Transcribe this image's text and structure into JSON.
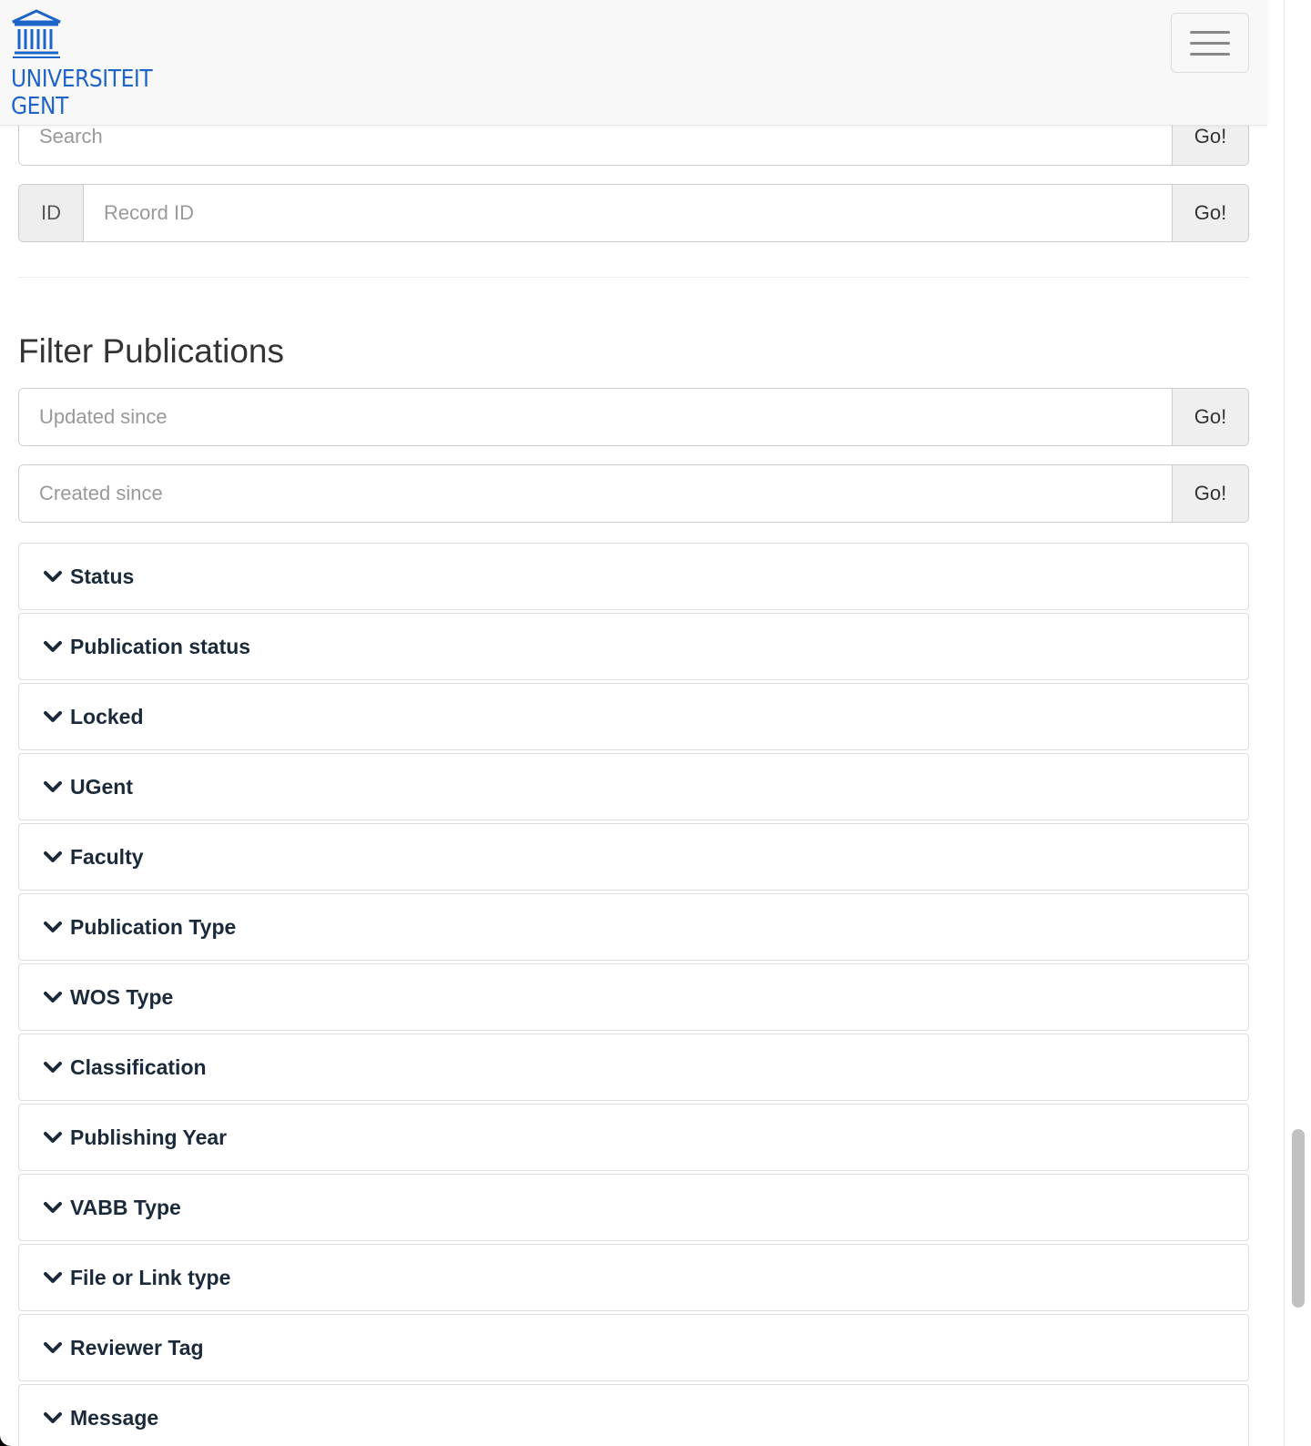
{
  "brand": {
    "line1": "UNIVERSITEIT",
    "line2": "GENT",
    "color": "#1E64C8"
  },
  "navbar": {
    "menu_icon": "hamburger-icon"
  },
  "search": {
    "placeholder": "Search",
    "go_label": "Go!"
  },
  "record_id": {
    "addon": "ID",
    "placeholder": "Record ID",
    "go_label": "Go!"
  },
  "filter": {
    "heading": "Filter Publications",
    "updated": {
      "placeholder": "Updated since",
      "go_label": "Go!"
    },
    "created": {
      "placeholder": "Created since",
      "go_label": "Go!"
    },
    "facets": [
      "Status",
      "Publication status",
      "Locked",
      "UGent",
      "Faculty",
      "Publication Type",
      "WOS Type",
      "Classification",
      "Publishing Year",
      "VABB Type",
      "File or Link type",
      "Reviewer Tag",
      "Message"
    ],
    "facet_icon": "chevron-down-icon"
  }
}
